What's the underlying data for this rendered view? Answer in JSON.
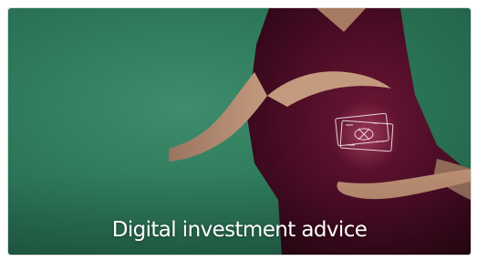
{
  "image": {
    "caption": "Digital investment advice",
    "subject": "person-hands-cupping-money-icon",
    "colors": {
      "background": "#2f7a5c",
      "shirt": "#4a0c25",
      "skin": "#b78b6f",
      "caption_text": "#ffffff"
    }
  }
}
